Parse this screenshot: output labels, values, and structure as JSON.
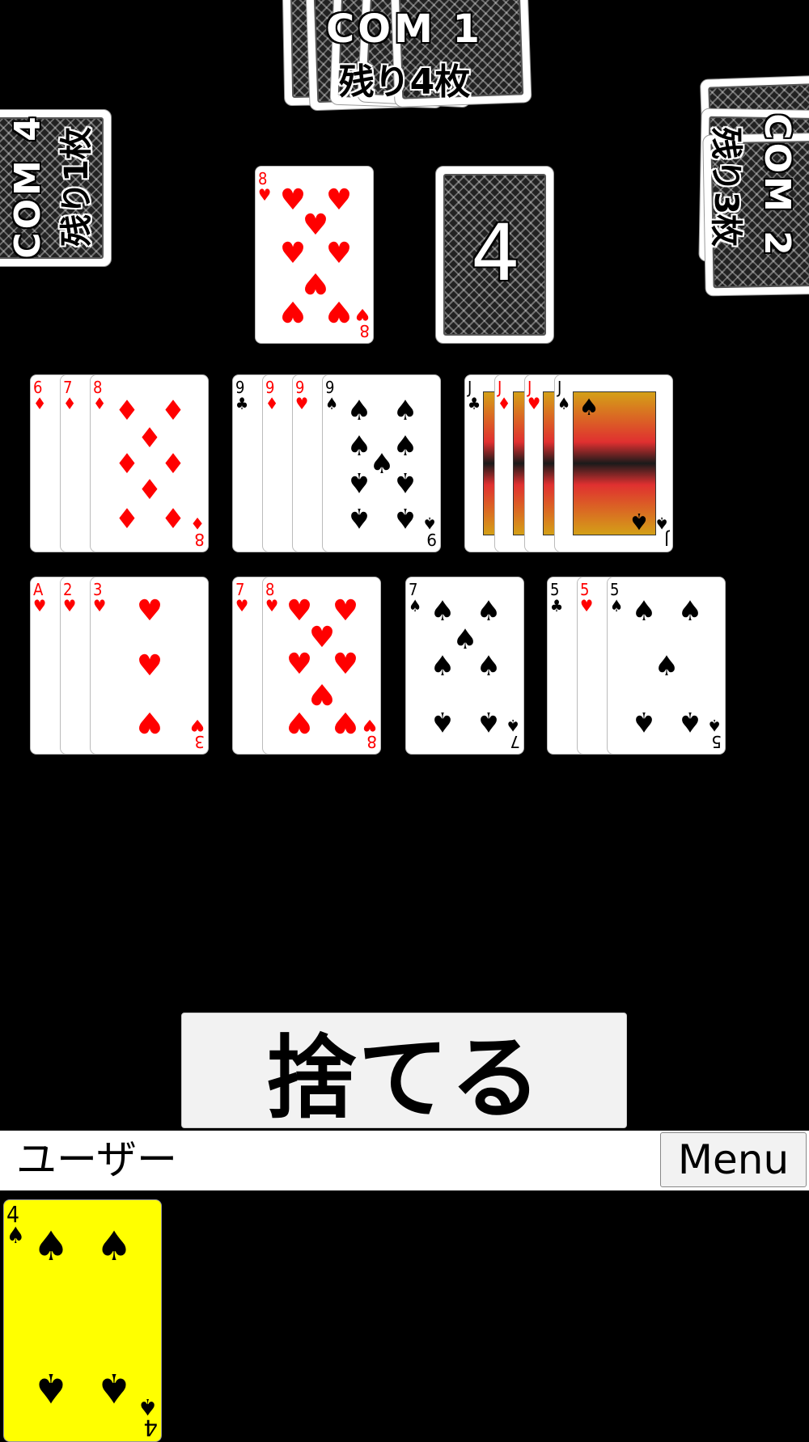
{
  "opponents": {
    "com1": {
      "name": "COM 1",
      "remaining": "残り4枚"
    },
    "com2": {
      "name": "COM 2",
      "remaining": "残り3枚"
    },
    "com4": {
      "name": "COM 4",
      "remaining": "残り1枚"
    }
  },
  "field": {
    "top_card": {
      "rank": "8",
      "suit": "hearts"
    },
    "deck_count": "4"
  },
  "played_groups": [
    {
      "cards": [
        {
          "rank": "6",
          "suit": "diamonds"
        },
        {
          "rank": "7",
          "suit": "diamonds"
        },
        {
          "rank": "8",
          "suit": "diamonds"
        }
      ]
    },
    {
      "cards": [
        {
          "rank": "9",
          "suit": "clubs"
        },
        {
          "rank": "9",
          "suit": "diamonds"
        },
        {
          "rank": "9",
          "suit": "hearts"
        },
        {
          "rank": "9",
          "suit": "spades"
        }
      ]
    },
    {
      "cards": [
        {
          "rank": "J",
          "suit": "clubs"
        },
        {
          "rank": "J",
          "suit": "diamonds"
        },
        {
          "rank": "J",
          "suit": "hearts"
        },
        {
          "rank": "J",
          "suit": "spades"
        }
      ]
    },
    {
      "cards": [
        {
          "rank": "A",
          "suit": "hearts"
        },
        {
          "rank": "2",
          "suit": "hearts"
        },
        {
          "rank": "3",
          "suit": "hearts"
        }
      ]
    },
    {
      "cards": [
        {
          "rank": "7",
          "suit": "hearts"
        },
        {
          "rank": "8",
          "suit": "hearts"
        }
      ]
    },
    {
      "cards": [
        {
          "rank": "7",
          "suit": "spades"
        }
      ]
    },
    {
      "cards": [
        {
          "rank": "5",
          "suit": "clubs"
        },
        {
          "rank": "5",
          "suit": "hearts"
        },
        {
          "rank": "5",
          "suit": "spades"
        }
      ]
    }
  ],
  "actions": {
    "discard_label": "捨てる",
    "menu_label": "Menu"
  },
  "user": {
    "name": "ユーザー",
    "hand": [
      {
        "rank": "4",
        "suit": "spades",
        "selected": true
      }
    ]
  },
  "colors": {
    "background": "#000000",
    "selected_card": "#ffff00",
    "red_suit": "#ff0000"
  },
  "icons": {
    "spades": "spade-icon",
    "hearts": "heart-icon",
    "diamonds": "diamond-icon",
    "clubs": "club-icon"
  }
}
